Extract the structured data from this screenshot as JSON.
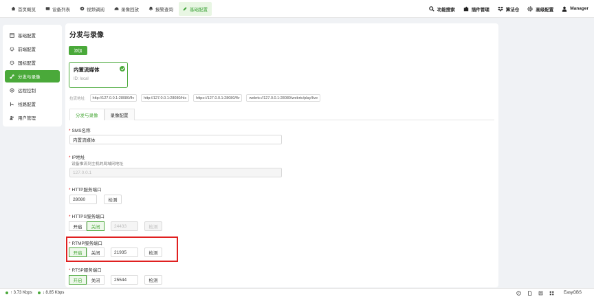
{
  "nav": [
    {
      "label": "首页概览",
      "icon": "home-icon"
    },
    {
      "label": "设备列表",
      "icon": "device-icon"
    },
    {
      "label": "视频调阅",
      "icon": "video-icon"
    },
    {
      "label": "录像回放",
      "icon": "cloud-icon"
    },
    {
      "label": "报警查询",
      "icon": "bell-icon"
    },
    {
      "label": "基础配置",
      "icon": "edit-icon",
      "active": true
    }
  ],
  "tools": [
    {
      "label": "功能搜索",
      "icon": "search-icon"
    },
    {
      "label": "插件管理",
      "icon": "puzzle-icon"
    },
    {
      "label": "算法仓",
      "icon": "dropbox-icon"
    },
    {
      "label": "高级配置",
      "icon": "gear-icon"
    },
    {
      "label": "Manager",
      "icon": "user-icon"
    }
  ],
  "sidebar": [
    {
      "label": "基础配置",
      "icon": "grid-icon"
    },
    {
      "label": "前端配置",
      "icon": "gear-icon"
    },
    {
      "label": "国标配置",
      "icon": "gear-icon"
    },
    {
      "label": "分发与录像",
      "icon": "link-icon",
      "active": true
    },
    {
      "label": "远程控制",
      "icon": "remote-icon"
    },
    {
      "label": "线路配置",
      "icon": "route-icon"
    },
    {
      "label": "用户管理",
      "icon": "users-icon"
    }
  ],
  "main": {
    "title": "分发与录像",
    "add_button": "添加",
    "card": {
      "name": "内置流媒体",
      "id": "ID: local"
    },
    "addr_label": "拉流地址:",
    "addresses": [
      "http://127.0.0.1:28080/flv",
      "http://127.0.0.1:28080/hls",
      "https://127.0.0.1:28080/flv",
      "webrtc://127.0.0.1:28080/webrtc/play/live"
    ],
    "tabs": [
      "分发与录像",
      "录像配置"
    ],
    "sms_name_label": "SMS名称",
    "sms_name_value": "内置流媒体",
    "ip_label": "IP地址",
    "ip_hint": "设备推流到主机的局域网地址",
    "ip_value": "127.0.0.1",
    "http_label": "HTTP服务端口",
    "http_value": "28080",
    "https_label": "HTTPS服务端口",
    "https_value": "24433",
    "rtmp_label": "RTMP服务端口",
    "rtmp_value": "21935",
    "rtsp_label": "RTSP服务端口",
    "rtsp_value": "25544",
    "on_label": "开启",
    "off_label": "关闭",
    "test_label": "检测"
  },
  "status": {
    "up": "↑ 3.73 Kbps",
    "down": "↓ 8.85 Kbps",
    "brand": "EasyGBS"
  },
  "colors": {
    "accent": "#4aa93a",
    "highlight": "#e02020"
  }
}
